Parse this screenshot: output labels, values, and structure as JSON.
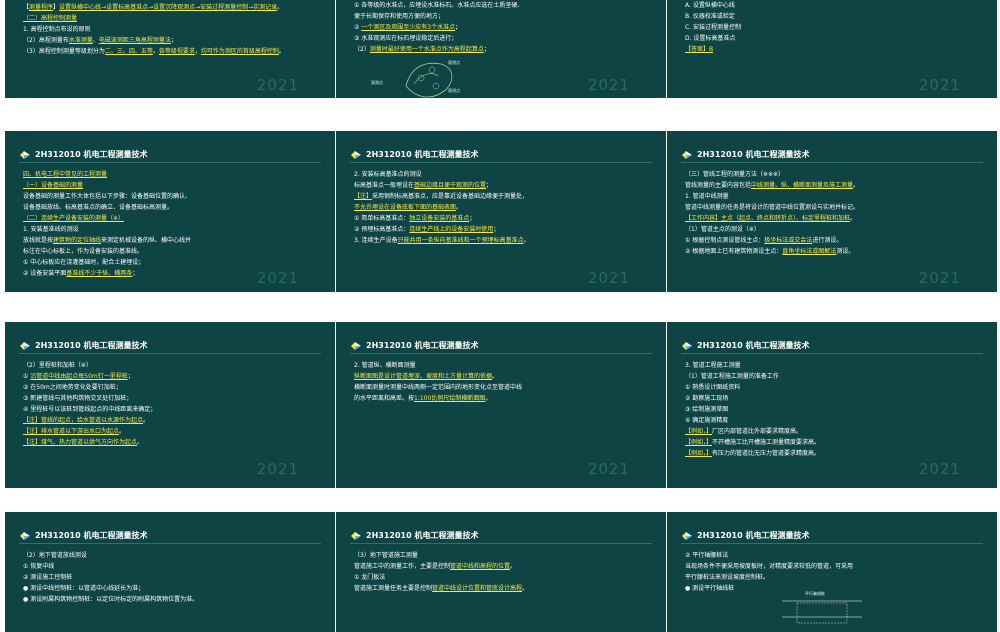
{
  "header": "2H312010  机电工程测量技术",
  "year": "2021",
  "slides": [
    {
      "has_header": false,
      "lines": [
        "【测量程序】设置纵横中心线→设置标高基准点→设置沉降观测点→安装过程测量控制→实测记录。",
        "（二）高程控制测量",
        "1. 高程控制点布设的原则",
        "（2）高程测量布水准测量、电磁波测距三角高程测量法；",
        "（3）高程控制测量等级划分为二、三、四、五等。各等级视要求，均可作为测区的首级高程控制。"
      ]
    },
    {
      "has_header": false,
      "lines": [
        "①  各等级的水准点，应埋设水准标石。水准点应选在土质坚硬、",
        "便于长期保存和使用方便的地方；",
        "②  一个测区及周围至少应有3个水准点；",
        "③  水准观测应在标石埋设稳定后进行；",
        "（2）测量时最好使用一个水准点作为高程起算点；"
      ],
      "map_labels": [
        "观测点",
        "观测点",
        "观测点"
      ]
    },
    {
      "has_header": false,
      "lines": [
        "A. 设置纵横中心线",
        "B. 仪器校准或检定",
        "C. 安装过程测量控制",
        "D. 设置标高基准点",
        "【答案】B"
      ]
    },
    {
      "has_header": true,
      "lines": [
        "四、机电工程中常见的工程测量",
        "（一）设备基础的测量",
        "设备基础的测量工作大体包括以下步骤：设备基础位置的确认、",
        "设备基础放线、标高基准点的确立、设备基础标高测量。",
        "（二）连续生产设备安装的测量（※）",
        "1. 安装基准线的测设",
        "放线就是按建筑物的定位轴线来测定机械设备的纵、横中心线并",
        "标注在中心标板上，作为设备安装的基准线。",
        "①  中心标板应在浇灌基础时，配合土建埋设；",
        "②  设备安装平面基准线不少于纵、横两条；"
      ]
    },
    {
      "has_header": true,
      "lines": [
        "2. 安装标高基准点的测设",
        "标高基准点一般埋设在基础边缘且便于观测的位置；",
        "【注】采用钢制标高基准点，应是靠近设备基础边缘便于测量处，",
        "不允许埋设在设备底板下面的基础表面。",
        "①  简单标高基准点：独立设备安装的基准点；",
        "②  预埋标高基准点：连续生产线上的设备安装时使用；",
        "3. 连续生产设备只能共用一条纵向基准线和一个预埋标高基准点。"
      ]
    },
    {
      "has_header": true,
      "lines": [
        "（三）管线工程的测量方法（※※※）",
        "管线测量的主要内容包括中线测量、纵、横断面测量及施工测量。",
        "1. 管道中线测量",
        "管道中线测量的任务是将设计的管道中线位置测设与实地并标记。",
        "【工作内容】主点（起点、终点和转折点）、标定里程桩和加桩。",
        "（1）管道主点的测设（※）",
        "①  根据控制点测设管线主点：极坐标法或交会法进行测设。",
        "②  根据地面上已有建筑物测设主点：直角坐标法或图解法测设。"
      ]
    },
    {
      "has_header": true,
      "lines": [
        "（2）里程桩和加桩（※）",
        "①  沿管道中线由起点每50m钉一里程桩；",
        "②  在50m之间地势变化处要钉加桩；",
        "③  新建管线与其他构筑物交叉处钉加桩；",
        "④  里程桩号以该桩到管线起点的中线距离来确定；",
        "【注】管线的起点，给水管道以水源作为起点。",
        "【注】排水管道以下游出水口为起点。",
        "【注】煤气、热力管道以供气方向作为起点。"
      ]
    },
    {
      "has_header": true,
      "lines": [
        "2. 管道纵、横断面测量",
        "纵断面图是设计管道埋深、坡度和土方量计算的依据。",
        "横断面测量时测量中线两侧一定范围内的地形变化点至管道中线",
        "的水平距离和高差。按1:100比例尺绘制横断面图。"
      ]
    },
    {
      "has_header": true,
      "lines": [
        "3. 管道工程施工测量",
        "（1）管道工程施工测量的准备工作",
        "①  熟悉设计图纸资料",
        "②  勘察施工现场",
        "③  绘制施测草图",
        "④  确定施测精度",
        "【例如，】厂区内部管道比外部要求精度高。",
        "【例如，】不开槽施工比开槽施工测量精度要求高。",
        "【例如，】有压力的管道比无压力管道要求精度高。"
      ]
    },
    {
      "has_header": true,
      "lines": [
        "（2）地下管道放线测设",
        "①  恢复中线",
        "②  测设施工控制桩",
        "●  测设中线控制桩：以管道中心线延长为准；",
        "●  测设附属构筑物控制桩：以定位时标定的附属构筑物位置为准。"
      ]
    },
    {
      "has_header": true,
      "lines": [
        "（3）地下管道施工测量",
        "管道施工中的测量工作，主要是控制管道中线和高程的位置。",
        "①  龙门板法",
        "管道施工测量任务主要是控制管道中线设计位置和管底设计高程。"
      ]
    },
    {
      "has_header": true,
      "lines": [
        "②  平行轴腰桩法",
        "当现场条件不便采用坡度板时，对精度要求较低的管道，可采用",
        "平行腰桩法来测设坡度控制桩。",
        "●  测设平行轴线桩"
      ],
      "diagram_label": "平行轴线桩"
    }
  ]
}
